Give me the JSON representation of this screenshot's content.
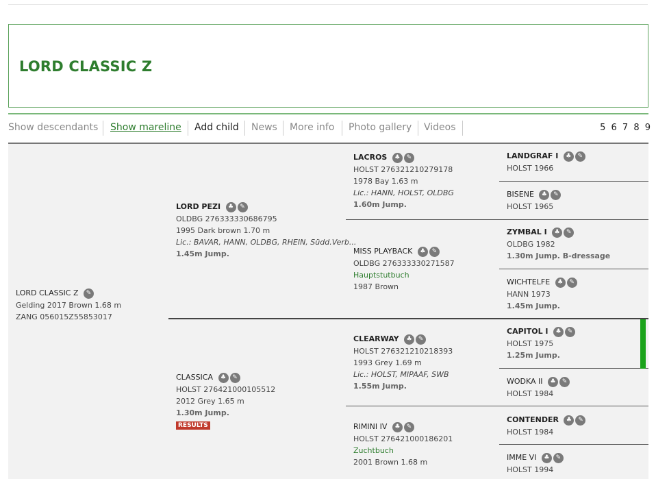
{
  "title": "LORD CLASSIC Z",
  "menu": {
    "show_descendants": "Show descendants",
    "show_mareline": "Show mareline",
    "add_child": "Add child",
    "news": "News",
    "more_info": "More info",
    "photo_gallery": "Photo gallery",
    "videos": "Videos",
    "pages": "5 6 7 8 9"
  },
  "subject": {
    "name": "LORD CLASSIC Z",
    "line1": "Gelding 2017 Brown 1.68 m",
    "line2": "ZANG 056015Z55853017"
  },
  "sire": {
    "name": "LORD PEZI",
    "reg": "OLDBG 276333330686795",
    "line": "1995 Dark brown 1.70 m",
    "lic": "Lic.: BAVAR, HANN, OLDBG, RHEIN, Südd.Verb...",
    "jump": "1.45m Jump."
  },
  "dam": {
    "name": "CLASSICA",
    "reg": "HOLST 276421000105512",
    "line": "2012 Grey 1.65 m",
    "jump": "1.30m Jump.",
    "badge": "RESULTS"
  },
  "ss": {
    "name": "LACROS",
    "reg": "HOLST 276321210279178",
    "line": "1978 Bay 1.63 m",
    "lic": "Lic.: HANN, HOLST, OLDBG",
    "jump": "1.60m Jump."
  },
  "sd": {
    "name": "MISS PLAYBACK",
    "reg": "OLDBG 276333330271587",
    "book": "Hauptstutbuch",
    "line": "1987 Brown"
  },
  "ds": {
    "name": "CLEARWAY",
    "reg": "HOLST 276321210218393",
    "line": "1993 Grey 1.69 m",
    "lic": "Lic.: HOLST, MIPAAF, SWB",
    "jump": "1.55m Jump."
  },
  "dd": {
    "name": "RIMINI IV",
    "reg": "HOLST 276421000186201",
    "book": "Zuchtbuch",
    "line": "2001 Brown 1.68 m"
  },
  "g": [
    {
      "name": "LANDGRAF I",
      "line": "HOLST 1966",
      "extra": ""
    },
    {
      "name": "BISENE",
      "line": "HOLST 1965",
      "extra": ""
    },
    {
      "name": "ZYMBAL I",
      "line": "OLDBG 1982",
      "extra": "1.30m Jump. B-dressage"
    },
    {
      "name": "WICHTELFE",
      "line": "HANN 1973",
      "extra": "1.45m Jump."
    },
    {
      "name": "CAPITOL I",
      "line": "HOLST 1975",
      "extra": "1.25m Jump."
    },
    {
      "name": "WODKA II",
      "line": "HOLST 1984",
      "extra": ""
    },
    {
      "name": "CONTENDER",
      "line": "HOLST 1984",
      "extra": ""
    },
    {
      "name": "IMME VI",
      "line": "HOLST 1994",
      "extra": ""
    }
  ],
  "icons": {
    "descendants": "descendants-icon",
    "edit": "edit-icon"
  },
  "colors": {
    "accent_green": "#2e7d2e",
    "results_red": "#c0392b",
    "highlight_bar": "#1aa31a"
  }
}
